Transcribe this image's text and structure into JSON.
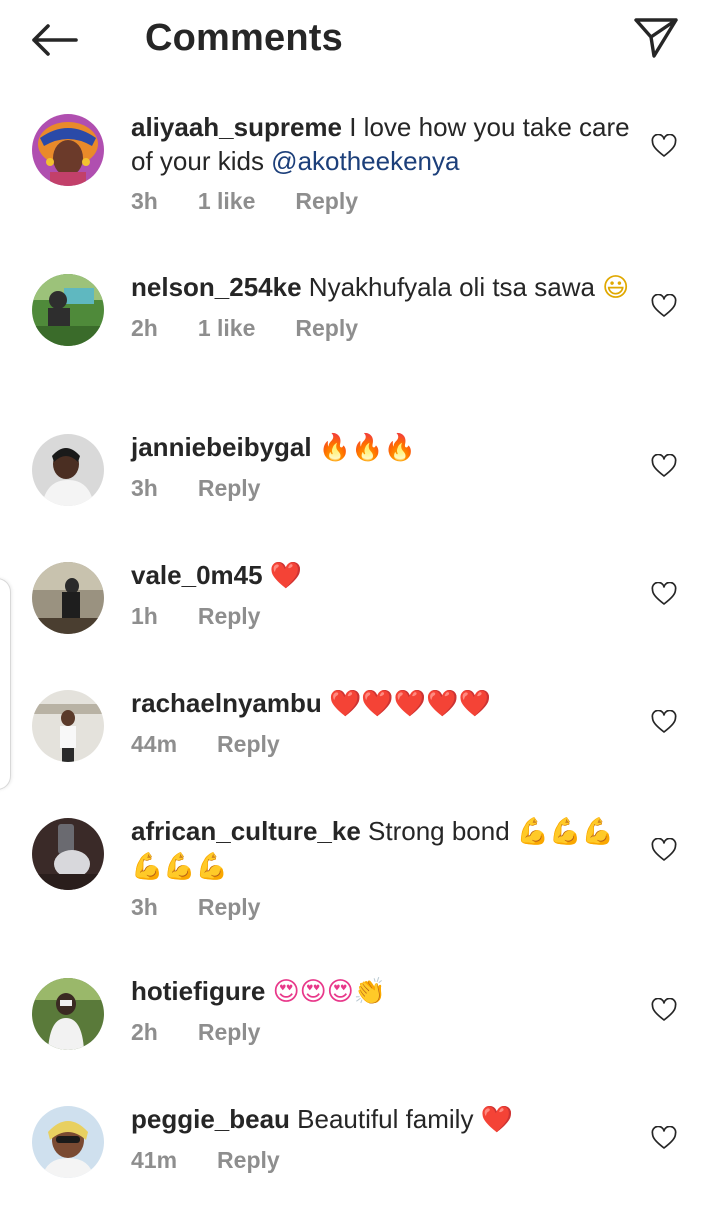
{
  "header": {
    "title": "Comments",
    "back_icon": "arrow-left-icon",
    "share_icon": "paper-plane-icon"
  },
  "colors": {
    "text": "#262626",
    "meta": "#8e8e8e",
    "mention": "#1c3f7a",
    "heart_emoji": "#e0162b",
    "fire_emoji": "#f5a623",
    "smile_emoji": "#fcc21b"
  },
  "comments": [
    {
      "username": "aliyaah_supreme",
      "text": " I love how you take care of your kids ",
      "mention": "@akotheekenya",
      "emoji": "",
      "time": "3h",
      "likes": "1 like",
      "reply": "Reply"
    },
    {
      "username": "nelson_254ke",
      "text": " Nyakhufyala oli tsa sawa ",
      "mention": "",
      "emoji": "😃",
      "time": "2h",
      "likes": "1 like",
      "reply": "Reply"
    },
    {
      "username": "janniebeibygal",
      "text": " ",
      "mention": "",
      "emoji": "🔥🔥🔥",
      "time": "3h",
      "likes": "",
      "reply": "Reply"
    },
    {
      "username": "vale_0m45",
      "text": " ",
      "mention": "",
      "emoji": "❤️",
      "time": "1h",
      "likes": "",
      "reply": "Reply"
    },
    {
      "username": "rachaelnyambu",
      "text": " ",
      "mention": "",
      "emoji": "❤️❤️❤️❤️❤️",
      "time": "44m",
      "likes": "",
      "reply": "Reply"
    },
    {
      "username": "african_culture_ke",
      "text": " Strong bond ",
      "mention": "",
      "emoji": "💪💪💪💪💪💪",
      "time": "3h",
      "likes": "",
      "reply": "Reply"
    },
    {
      "username": "hotiefigure",
      "text": " ",
      "mention": "",
      "emoji": "😍😍😍👏",
      "time": "2h",
      "likes": "",
      "reply": "Reply"
    },
    {
      "username": "peggie_beau",
      "text": " Beautiful family ",
      "mention": "",
      "emoji": "❤️",
      "time": "41m",
      "likes": "",
      "reply": "Reply"
    }
  ]
}
